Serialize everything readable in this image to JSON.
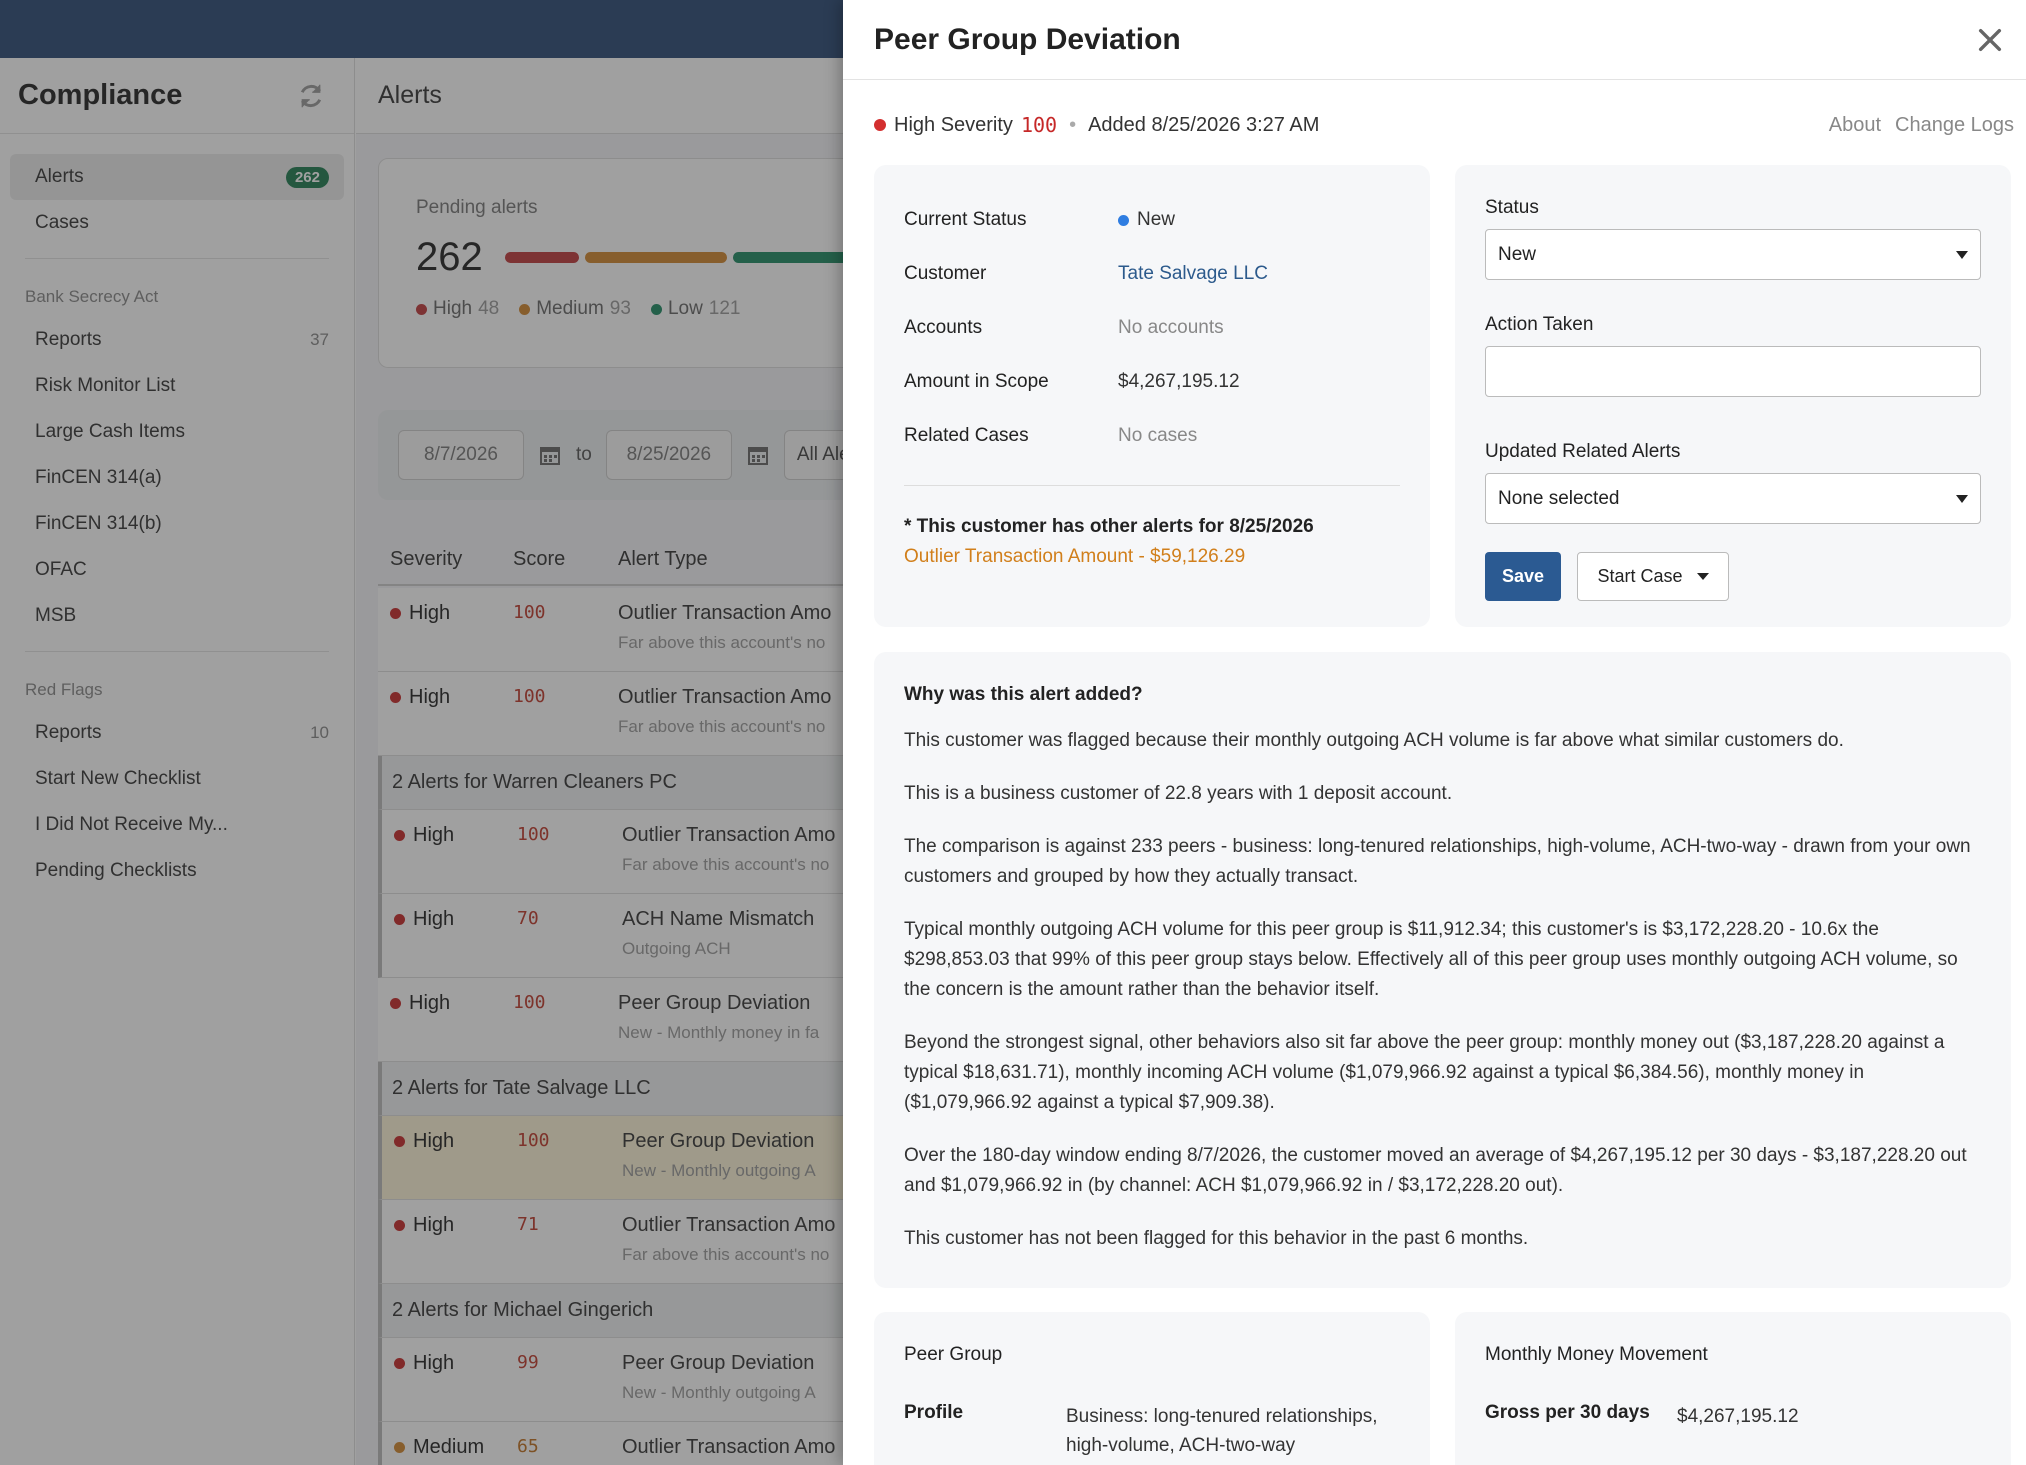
{
  "sidebar": {
    "title": "Compliance",
    "alerts_label": "Alerts",
    "alerts_badge": "262",
    "cases_label": "Cases",
    "bsa_section": "Bank Secrecy Act",
    "bsa_items": [
      {
        "label": "Reports",
        "count": "37"
      },
      {
        "label": "Risk Monitor List",
        "count": ""
      },
      {
        "label": "Large Cash Items",
        "count": ""
      },
      {
        "label": "FinCEN 314(a)",
        "count": ""
      },
      {
        "label": "FinCEN 314(b)",
        "count": ""
      },
      {
        "label": "OFAC",
        "count": ""
      },
      {
        "label": "MSB",
        "count": ""
      }
    ],
    "red_flags_section": "Red Flags",
    "red_flag_items": [
      {
        "label": "Reports",
        "count": "10"
      },
      {
        "label": "Start New Checklist",
        "count": ""
      },
      {
        "label": "I Did Not Receive My...",
        "count": ""
      },
      {
        "label": "Pending Checklists",
        "count": ""
      }
    ]
  },
  "main": {
    "title": "Alerts",
    "pending": {
      "label": "Pending alerts",
      "total": "262",
      "high_label": "High",
      "high_count": "48",
      "medium_label": "Medium",
      "medium_count": "93",
      "low_label": "Low",
      "low_count": "121"
    },
    "filters": {
      "date_from": "8/7/2026",
      "to_label": "to",
      "date_to": "8/25/2026",
      "type_select": "All Aler"
    },
    "columns": {
      "severity": "Severity",
      "score": "Score",
      "alert_type": "Alert Type"
    },
    "rows": [
      {
        "severity": "High",
        "score": "100",
        "type": "Outlier Transaction Amo",
        "sub": "Far above this account's no"
      },
      {
        "severity": "High",
        "score": "100",
        "type": "Outlier Transaction Amo",
        "sub": "Far above this account's no"
      },
      {
        "group": "2 Alerts for Warren Cleaners PC"
      },
      {
        "severity": "High",
        "score": "100",
        "type": "Outlier Transaction Amo",
        "sub": "Far above this account's no"
      },
      {
        "severity": "High",
        "score": "70",
        "type": "ACH Name Mismatch",
        "sub": "Outgoing ACH"
      },
      {
        "severity": "High",
        "score": "100",
        "type": "Peer Group Deviation",
        "sub": "New - Monthly money in fa"
      },
      {
        "group": "2 Alerts for Tate Salvage LLC"
      },
      {
        "severity": "High",
        "score": "100",
        "type": "Peer Group Deviation",
        "sub": "New - Monthly outgoing A"
      },
      {
        "severity": "High",
        "score": "71",
        "type": "Outlier Transaction Amo",
        "sub": "Far above this account's no"
      },
      {
        "group": "2 Alerts for Michael Gingerich"
      },
      {
        "severity": "High",
        "score": "99",
        "type": "Peer Group Deviation",
        "sub": "New - Monthly outgoing A"
      },
      {
        "severity": "Medium",
        "score": "65",
        "type": "Outlier Transaction Amo",
        "sub": ""
      }
    ]
  },
  "drawer": {
    "title": "Peer Group Deviation",
    "severity_label": "High Severity",
    "severity_score": "100",
    "added": "Added 8/25/2026 3:27 AM",
    "about_link": "About",
    "changelog_link": "Change Logs",
    "info": {
      "status_label": "Current Status",
      "status_value": "New",
      "customer_label": "Customer",
      "customer_value": "Tate Salvage LLC",
      "accounts_label": "Accounts",
      "accounts_value": "No accounts",
      "amount_label": "Amount in Scope",
      "amount_value": "$4,267,195.12",
      "related_label": "Related Cases",
      "related_value": "No cases",
      "other_alerts_title": "* This customer has other alerts for 8/25/2026",
      "other_alert_link": "Outlier Transaction Amount - $59,126.29"
    },
    "action": {
      "status_label": "Status",
      "status_value": "New",
      "action_label": "Action Taken",
      "action_value": "",
      "related_label": "Updated Related Alerts",
      "related_value": "None selected",
      "save": "Save",
      "start_case": "Start Case"
    },
    "why": {
      "title": "Why was this alert added?",
      "p1": "This customer was flagged because their monthly outgoing ACH volume is far above what similar customers do.",
      "p2": "This is a business customer of 22.8 years with 1 deposit account.",
      "p3": "The comparison is against 233 peers - business: long-tenured relationships, high-volume, ACH-two-way - drawn from your own customers and grouped by how they actually transact.",
      "p4": "Typical monthly outgoing ACH volume for this peer group is $11,912.34; this customer's is $3,172,228.20 - 10.6x the $298,853.03 that 99% of this peer group stays below. Effectively all of this peer group uses monthly outgoing ACH volume, so the concern is the amount rather than the behavior itself.",
      "p5": "Beyond the strongest signal, other behaviors also sit far above the peer group: monthly money out ($3,187,228.20 against a typical $18,631.71), monthly incoming ACH volume ($1,079,966.92 against a typical $6,384.56), monthly money in ($1,079,966.92 against a typical $7,909.38).",
      "p6": "Over the 180-day window ending 8/7/2026, the customer moved an average of $4,267,195.12 per 30 days - $3,187,228.20 out and $1,079,966.92 in (by channel: ACH $1,079,966.92 in / $3,172,228.20 out).",
      "p7": "This customer has not been flagged for this behavior in the past 6 months."
    },
    "peer": {
      "title": "Peer Group",
      "profile_label": "Profile",
      "profile_value": "Business: long-tenured relationships, high-volume, ACH-two-way"
    },
    "money": {
      "title": "Monthly Money Movement",
      "gross_label": "Gross per 30 days",
      "gross_value": "$4,267,195.12"
    }
  },
  "colors": {
    "high": "#c62828",
    "medium": "#d2872f",
    "low": "#1e8a63",
    "accent": "#2b5a92",
    "topbar": "#2b4a75"
  }
}
